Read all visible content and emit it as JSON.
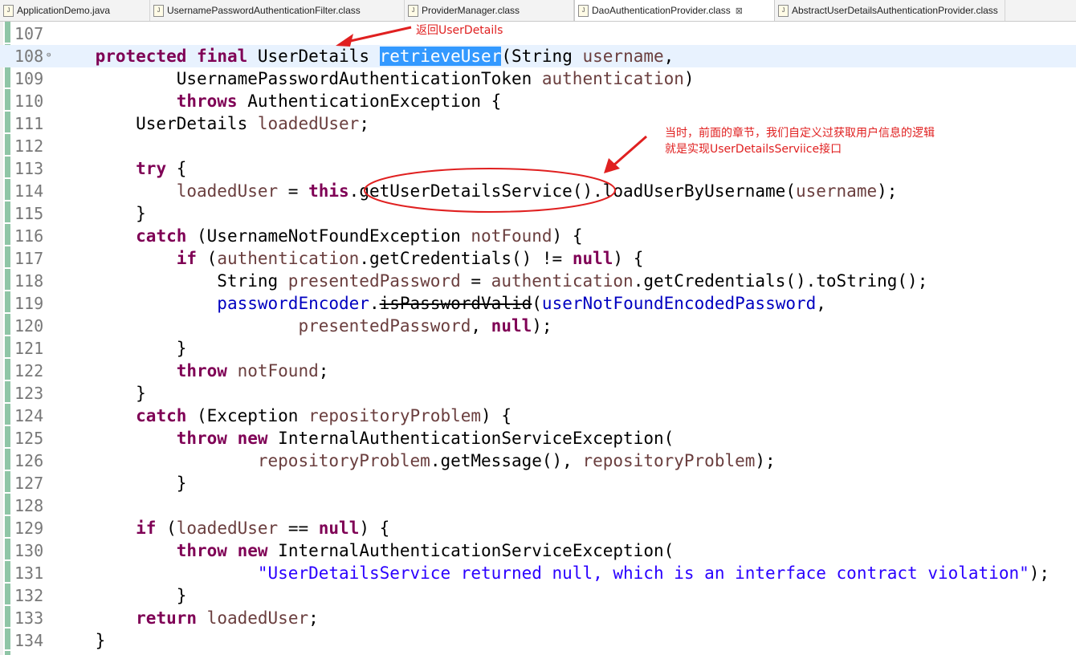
{
  "tabs": [
    {
      "label": "ApplicationDemo.java",
      "icon": "java-file-icon",
      "active": false
    },
    {
      "label": "UsernamePasswordAuthenticationFilter.class",
      "icon": "class-file-icon",
      "active": false
    },
    {
      "label": "ProviderManager.class",
      "icon": "class-file-icon",
      "active": false
    },
    {
      "label": "DaoAuthenticationProvider.class",
      "icon": "class-file-icon",
      "active": true,
      "close": "⊠"
    },
    {
      "label": "AbstractUserDetailsAuthenticationProvider.class",
      "icon": "class-file-icon",
      "active": false
    }
  ],
  "annotations": {
    "return_note": "返回UserDetails",
    "service_note_line1": "当时，前面的章节，我们自定义过获取用户信息的逻辑",
    "service_note_line2": "就是实现UserDetailsServiice接口"
  },
  "colors": {
    "keyword": "#7f0055",
    "variable": "#6a3e3e",
    "field": "#0000c0",
    "string": "#2a00ff",
    "annotation": "#e02020"
  },
  "lines": [
    {
      "num": "107",
      "tokens": []
    },
    {
      "num": "108",
      "current": true,
      "tokens": [
        [
          "",
          "    "
        ],
        [
          "kw",
          "protected"
        ],
        [
          "",
          " "
        ],
        [
          "kw",
          "final"
        ],
        [
          "",
          " UserDetails "
        ],
        [
          "sel",
          "retrieveUser"
        ],
        [
          "",
          "(String "
        ],
        [
          "var",
          "username"
        ],
        [
          "",
          ","
        ]
      ]
    },
    {
      "num": "109",
      "tokens": [
        [
          "",
          "            UsernamePasswordAuthenticationToken "
        ],
        [
          "var",
          "authentication"
        ],
        [
          "",
          ")"
        ]
      ]
    },
    {
      "num": "110",
      "tokens": [
        [
          "",
          "            "
        ],
        [
          "kw",
          "throws"
        ],
        [
          "",
          " AuthenticationException {"
        ]
      ]
    },
    {
      "num": "111",
      "tokens": [
        [
          "",
          "        UserDetails "
        ],
        [
          "var",
          "loadedUser"
        ],
        [
          "",
          ";"
        ]
      ]
    },
    {
      "num": "112",
      "tokens": []
    },
    {
      "num": "113",
      "tokens": [
        [
          "",
          "        "
        ],
        [
          "kw",
          "try"
        ],
        [
          "",
          " {"
        ]
      ]
    },
    {
      "num": "114",
      "tokens": [
        [
          "",
          "            "
        ],
        [
          "var",
          "loadedUser"
        ],
        [
          "",
          " = "
        ],
        [
          "kw",
          "this"
        ],
        [
          "",
          ".getUserDetailsService().loadUserByUsername("
        ],
        [
          "var",
          "username"
        ],
        [
          "",
          ");"
        ]
      ]
    },
    {
      "num": "115",
      "tokens": [
        [
          "",
          "        }"
        ]
      ]
    },
    {
      "num": "116",
      "tokens": [
        [
          "",
          "        "
        ],
        [
          "kw",
          "catch"
        ],
        [
          "",
          " (UsernameNotFoundException "
        ],
        [
          "var",
          "notFound"
        ],
        [
          "",
          ") {"
        ]
      ]
    },
    {
      "num": "117",
      "tokens": [
        [
          "",
          "            "
        ],
        [
          "kw",
          "if"
        ],
        [
          "",
          " ("
        ],
        [
          "var",
          "authentication"
        ],
        [
          "",
          ".getCredentials() != "
        ],
        [
          "kw",
          "null"
        ],
        [
          "",
          ") {"
        ]
      ]
    },
    {
      "num": "118",
      "tokens": [
        [
          "",
          "                String "
        ],
        [
          "var",
          "presentedPassword"
        ],
        [
          "",
          " = "
        ],
        [
          "var",
          "authentication"
        ],
        [
          "",
          ".getCredentials().toString();"
        ]
      ]
    },
    {
      "num": "119",
      "tokens": [
        [
          "",
          "                "
        ],
        [
          "fld",
          "passwordEncoder"
        ],
        [
          "",
          "."
        ],
        [
          "strike",
          "isPasswordValid"
        ],
        [
          "",
          "("
        ],
        [
          "fld",
          "userNotFoundEncodedPassword"
        ],
        [
          "",
          ","
        ]
      ]
    },
    {
      "num": "120",
      "tokens": [
        [
          "",
          "                        "
        ],
        [
          "var",
          "presentedPassword"
        ],
        [
          "",
          ", "
        ],
        [
          "kw",
          "null"
        ],
        [
          "",
          ");"
        ]
      ]
    },
    {
      "num": "121",
      "tokens": [
        [
          "",
          "            }"
        ]
      ]
    },
    {
      "num": "122",
      "tokens": [
        [
          "",
          "            "
        ],
        [
          "kw",
          "throw"
        ],
        [
          "",
          " "
        ],
        [
          "var",
          "notFound"
        ],
        [
          "",
          ";"
        ]
      ]
    },
    {
      "num": "123",
      "tokens": [
        [
          "",
          "        }"
        ]
      ]
    },
    {
      "num": "124",
      "tokens": [
        [
          "",
          "        "
        ],
        [
          "kw",
          "catch"
        ],
        [
          "",
          " (Exception "
        ],
        [
          "var",
          "repositoryProblem"
        ],
        [
          "",
          ") {"
        ]
      ]
    },
    {
      "num": "125",
      "tokens": [
        [
          "",
          "            "
        ],
        [
          "kw",
          "throw"
        ],
        [
          "",
          " "
        ],
        [
          "kw",
          "new"
        ],
        [
          "",
          " InternalAuthenticationServiceException("
        ]
      ]
    },
    {
      "num": "126",
      "tokens": [
        [
          "",
          "                    "
        ],
        [
          "var",
          "repositoryProblem"
        ],
        [
          "",
          ".getMessage(), "
        ],
        [
          "var",
          "repositoryProblem"
        ],
        [
          "",
          ");"
        ]
      ]
    },
    {
      "num": "127",
      "tokens": [
        [
          "",
          "            }"
        ]
      ]
    },
    {
      "num": "128",
      "tokens": []
    },
    {
      "num": "129",
      "tokens": [
        [
          "",
          "        "
        ],
        [
          "kw",
          "if"
        ],
        [
          "",
          " ("
        ],
        [
          "var",
          "loadedUser"
        ],
        [
          "",
          " == "
        ],
        [
          "kw",
          "null"
        ],
        [
          "",
          ") {"
        ]
      ]
    },
    {
      "num": "130",
      "tokens": [
        [
          "",
          "            "
        ],
        [
          "kw",
          "throw"
        ],
        [
          "",
          " "
        ],
        [
          "kw",
          "new"
        ],
        [
          "",
          " InternalAuthenticationServiceException("
        ]
      ]
    },
    {
      "num": "131",
      "tokens": [
        [
          "",
          "                    "
        ],
        [
          "str",
          "\"UserDetailsService returned null, which is an interface contract violation\""
        ],
        [
          "",
          ");"
        ]
      ]
    },
    {
      "num": "132",
      "tokens": [
        [
          "",
          "            }"
        ]
      ]
    },
    {
      "num": "133",
      "tokens": [
        [
          "",
          "        "
        ],
        [
          "kw",
          "return"
        ],
        [
          "",
          " "
        ],
        [
          "var",
          "loadedUser"
        ],
        [
          "",
          ";"
        ]
      ]
    },
    {
      "num": "134",
      "tokens": [
        [
          "",
          "    }"
        ]
      ]
    }
  ]
}
